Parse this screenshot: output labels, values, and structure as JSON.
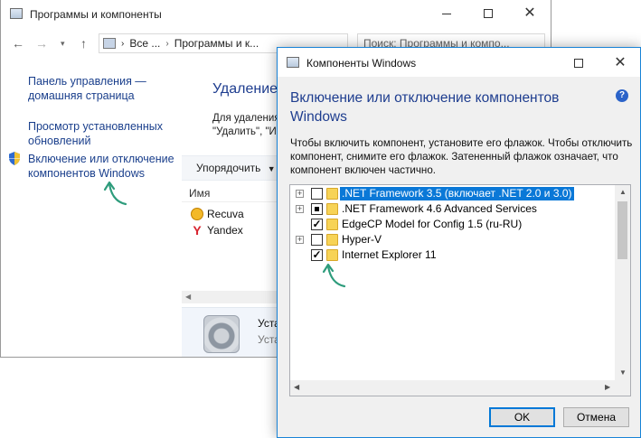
{
  "bg_window": {
    "title": "Программы и компоненты",
    "address": {
      "part1": "Все ...",
      "part2": "Программы и к..."
    },
    "search_placeholder": "Поиск: Программы и компо...",
    "sidebar": {
      "home_link": "Панель управления — домашняя страница",
      "updates_link": "Просмотр установленных обновлений",
      "features_link": "Включение или отключение компонентов Windows"
    },
    "main": {
      "title": "Удаление",
      "description": "Для удаления \"Удалить\", \"И",
      "organize_label": "Упорядочить",
      "column_name": "Имя",
      "programs": [
        "Recuva",
        "Yandex"
      ],
      "details_name": "Уста",
      "details_sub": "Уста"
    }
  },
  "dialog": {
    "title": "Компоненты Windows",
    "header": "Включение или отключение компонентов Windows",
    "description": "Чтобы включить компонент, установите его флажок. Чтобы отключить компонент, снимите его флажок. Затененный флажок означает, что компонент включен частично.",
    "features": [
      {
        "label": ".NET Framework 3.5 (включает .NET 2.0 и 3.0)",
        "state": "unchecked",
        "expandable": true,
        "selected": true
      },
      {
        "label": ".NET Framework 4.6 Advanced Services",
        "state": "partial",
        "expandable": true,
        "selected": false
      },
      {
        "label": "EdgeCP Model for Config 1.5 (ru-RU)",
        "state": "checked",
        "expandable": false,
        "selected": false
      },
      {
        "label": "Hyper-V",
        "state": "unchecked",
        "expandable": true,
        "selected": false
      },
      {
        "label": "Internet Explorer 11",
        "state": "checked",
        "expandable": false,
        "selected": false
      }
    ],
    "ok_label": "OK",
    "cancel_label": "Отмена"
  },
  "colors": {
    "accent": "#0a78d7",
    "link": "#1a3f8c",
    "heading": "#1e3d8f",
    "annotation": "#2e9c7c"
  }
}
